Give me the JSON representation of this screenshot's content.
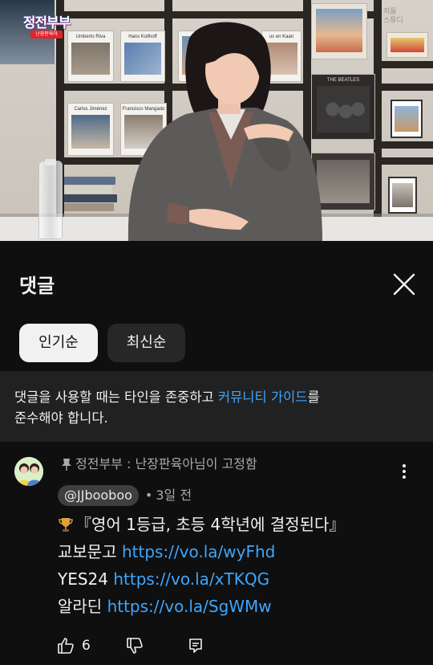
{
  "video": {
    "channel_badge": "정전부부",
    "channel_badge_sub": "난장판육아",
    "wall_text": "저들\n스튜디",
    "books": [
      "Umberto Riva",
      "Hans Kollhoff",
      "us en Kaan",
      "Carlos Jiménez",
      "Francisco Mangado",
      "THE BEATLES"
    ]
  },
  "panel": {
    "title": "댓글",
    "close_label": "close",
    "sort_chips": [
      {
        "label": "인기순",
        "selected": true
      },
      {
        "label": "최신순",
        "selected": false
      }
    ],
    "guideline": {
      "text_before": "댓글을 사용할 때는 타인을 존중하고 ",
      "link": "커뮤니티 가이드",
      "text_after": "를",
      "line2": "준수해야 합니다."
    }
  },
  "comment": {
    "pinned_by": "정전부부 : 난장판육아님이 고정함",
    "author": "@JJbooboo",
    "time": "3일 전",
    "line1": "『영어 1등급, 초등 4학년에 결정된다』",
    "stores": [
      {
        "name": "교보문고",
        "url": "https://vo.la/wyFhd"
      },
      {
        "name": "YES24",
        "url": "https://vo.la/xTKQG"
      },
      {
        "name": "알라딘",
        "url": "https://vo.la/SgWMw"
      }
    ],
    "like_count": "6"
  },
  "colors": {
    "background": "#0f0f0f",
    "link": "#3ea6ff",
    "chip_active": "#f1f1f1",
    "chip_inactive": "#272727",
    "guide_bg": "#212121"
  }
}
